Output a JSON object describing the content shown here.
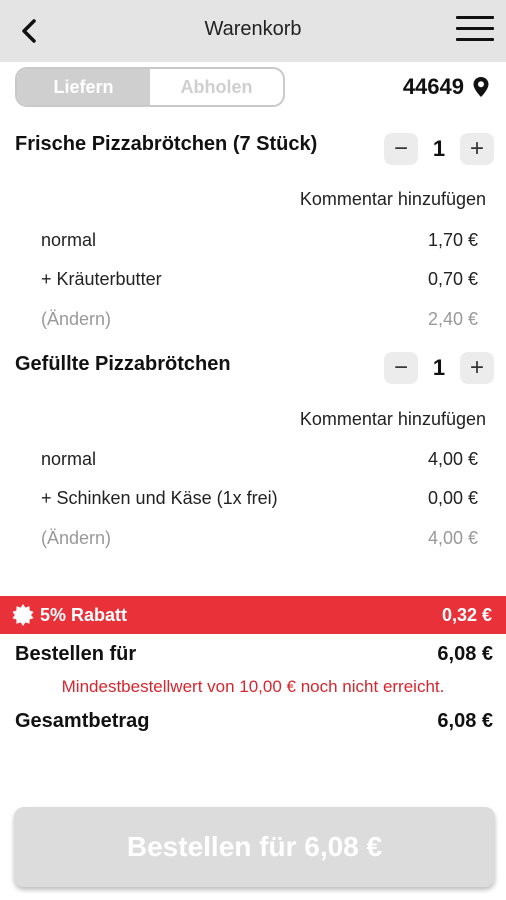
{
  "header": {
    "title": "Warenkorb",
    "back_icon": "chevron-left-icon",
    "menu_icon": "hamburger-icon"
  },
  "mode": {
    "delivery_label": "Liefern",
    "pickup_label": "Abholen",
    "active": "delivery"
  },
  "location": {
    "zip": "44649",
    "icon": "location-pin-icon"
  },
  "items": [
    {
      "name": "Frische Pizzabrötchen (7 Stück)",
      "quantity": "1",
      "comment_label": "Kommentar hinzufügen",
      "lines": [
        {
          "label": "normal",
          "price": "1,70 €"
        },
        {
          "label": "+ Kräuterbutter",
          "price": "0,70 €"
        },
        {
          "label": "(Ändern)",
          "price": "2,40 €"
        }
      ]
    },
    {
      "name": "Gefüllte Pizzabrötchen",
      "quantity": "1",
      "comment_label": "Kommentar hinzufügen",
      "lines": [
        {
          "label": "normal",
          "price": "4,00 €"
        },
        {
          "label": "+ Schinken und Käse (1x frei)",
          "price": "0,00 €"
        },
        {
          "label": "(Ändern)",
          "price": "4,00 €"
        }
      ]
    }
  ],
  "discount": {
    "label": "5% Rabatt",
    "value": "0,32 €",
    "icon": "badge-icon",
    "color": "#e9313a"
  },
  "order_for": {
    "label": "Bestellen für",
    "value": "6,08 €"
  },
  "warning": "Mindestbestellwert von 10,00 € noch nicht erreicht.",
  "total": {
    "label": "Gesamtbetrag",
    "value": "6,08 €"
  },
  "order_button": "Bestellen für 6,08 €",
  "qty_minus": "−",
  "qty_plus": "+"
}
